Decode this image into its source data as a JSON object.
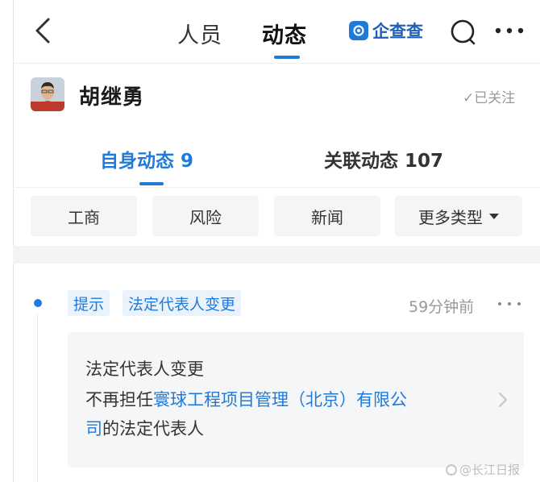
{
  "nav": {
    "tab_people": "人员",
    "tab_activity": "动态",
    "brand": "企查查"
  },
  "person": {
    "name": "胡继勇",
    "follow_status": "✓已关注"
  },
  "subtabs": {
    "self": "自身动态 9",
    "related": "关联动态 107"
  },
  "filters": {
    "business": "工商",
    "risk": "风险",
    "news": "新闻",
    "more_types": "更多类型"
  },
  "feed": [
    {
      "tags": [
        "提示",
        "法定代表人变更"
      ],
      "time": "59分钟前",
      "title": "法定代表人变更",
      "line2_prefix": "不再担任",
      "company_part1": "寰球工程项目管理（北京）有限公",
      "company_part2": "司",
      "line3_suffix": "的法定代表人"
    }
  ],
  "watermark": "@长江日报",
  "colors": {
    "accent": "#1f7ad9",
    "tag_bg": "#eaf3fc",
    "filter_bg": "#f4f5f7",
    "card_bg": "#f5f6f8"
  }
}
